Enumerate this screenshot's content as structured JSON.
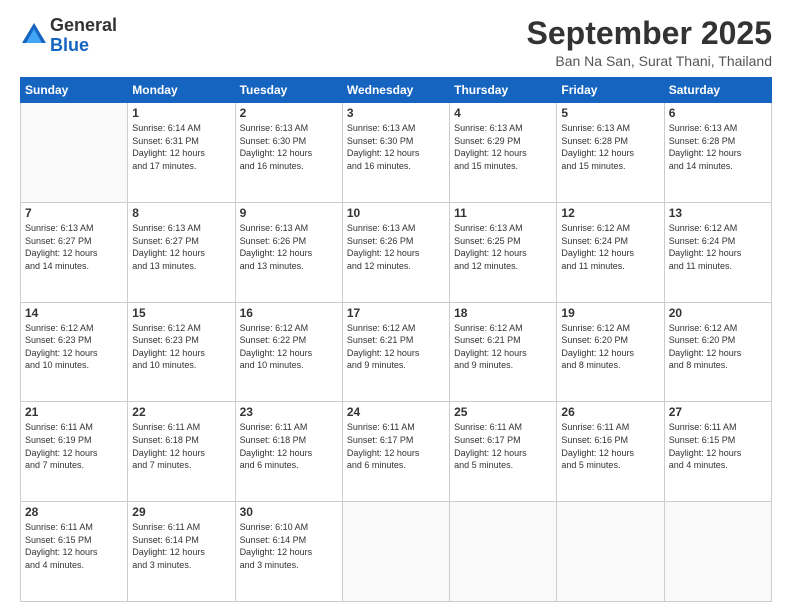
{
  "header": {
    "logo_general": "General",
    "logo_blue": "Blue",
    "title": "September 2025",
    "subtitle": "Ban Na San, Surat Thani, Thailand"
  },
  "days_of_week": [
    "Sunday",
    "Monday",
    "Tuesday",
    "Wednesday",
    "Thursday",
    "Friday",
    "Saturday"
  ],
  "weeks": [
    [
      {
        "day": "",
        "info": ""
      },
      {
        "day": "1",
        "info": "Sunrise: 6:14 AM\nSunset: 6:31 PM\nDaylight: 12 hours\nand 17 minutes."
      },
      {
        "day": "2",
        "info": "Sunrise: 6:13 AM\nSunset: 6:30 PM\nDaylight: 12 hours\nand 16 minutes."
      },
      {
        "day": "3",
        "info": "Sunrise: 6:13 AM\nSunset: 6:30 PM\nDaylight: 12 hours\nand 16 minutes."
      },
      {
        "day": "4",
        "info": "Sunrise: 6:13 AM\nSunset: 6:29 PM\nDaylight: 12 hours\nand 15 minutes."
      },
      {
        "day": "5",
        "info": "Sunrise: 6:13 AM\nSunset: 6:28 PM\nDaylight: 12 hours\nand 15 minutes."
      },
      {
        "day": "6",
        "info": "Sunrise: 6:13 AM\nSunset: 6:28 PM\nDaylight: 12 hours\nand 14 minutes."
      }
    ],
    [
      {
        "day": "7",
        "info": "Sunrise: 6:13 AM\nSunset: 6:27 PM\nDaylight: 12 hours\nand 14 minutes."
      },
      {
        "day": "8",
        "info": "Sunrise: 6:13 AM\nSunset: 6:27 PM\nDaylight: 12 hours\nand 13 minutes."
      },
      {
        "day": "9",
        "info": "Sunrise: 6:13 AM\nSunset: 6:26 PM\nDaylight: 12 hours\nand 13 minutes."
      },
      {
        "day": "10",
        "info": "Sunrise: 6:13 AM\nSunset: 6:26 PM\nDaylight: 12 hours\nand 12 minutes."
      },
      {
        "day": "11",
        "info": "Sunrise: 6:13 AM\nSunset: 6:25 PM\nDaylight: 12 hours\nand 12 minutes."
      },
      {
        "day": "12",
        "info": "Sunrise: 6:12 AM\nSunset: 6:24 PM\nDaylight: 12 hours\nand 11 minutes."
      },
      {
        "day": "13",
        "info": "Sunrise: 6:12 AM\nSunset: 6:24 PM\nDaylight: 12 hours\nand 11 minutes."
      }
    ],
    [
      {
        "day": "14",
        "info": "Sunrise: 6:12 AM\nSunset: 6:23 PM\nDaylight: 12 hours\nand 10 minutes."
      },
      {
        "day": "15",
        "info": "Sunrise: 6:12 AM\nSunset: 6:23 PM\nDaylight: 12 hours\nand 10 minutes."
      },
      {
        "day": "16",
        "info": "Sunrise: 6:12 AM\nSunset: 6:22 PM\nDaylight: 12 hours\nand 10 minutes."
      },
      {
        "day": "17",
        "info": "Sunrise: 6:12 AM\nSunset: 6:21 PM\nDaylight: 12 hours\nand 9 minutes."
      },
      {
        "day": "18",
        "info": "Sunrise: 6:12 AM\nSunset: 6:21 PM\nDaylight: 12 hours\nand 9 minutes."
      },
      {
        "day": "19",
        "info": "Sunrise: 6:12 AM\nSunset: 6:20 PM\nDaylight: 12 hours\nand 8 minutes."
      },
      {
        "day": "20",
        "info": "Sunrise: 6:12 AM\nSunset: 6:20 PM\nDaylight: 12 hours\nand 8 minutes."
      }
    ],
    [
      {
        "day": "21",
        "info": "Sunrise: 6:11 AM\nSunset: 6:19 PM\nDaylight: 12 hours\nand 7 minutes."
      },
      {
        "day": "22",
        "info": "Sunrise: 6:11 AM\nSunset: 6:18 PM\nDaylight: 12 hours\nand 7 minutes."
      },
      {
        "day": "23",
        "info": "Sunrise: 6:11 AM\nSunset: 6:18 PM\nDaylight: 12 hours\nand 6 minutes."
      },
      {
        "day": "24",
        "info": "Sunrise: 6:11 AM\nSunset: 6:17 PM\nDaylight: 12 hours\nand 6 minutes."
      },
      {
        "day": "25",
        "info": "Sunrise: 6:11 AM\nSunset: 6:17 PM\nDaylight: 12 hours\nand 5 minutes."
      },
      {
        "day": "26",
        "info": "Sunrise: 6:11 AM\nSunset: 6:16 PM\nDaylight: 12 hours\nand 5 minutes."
      },
      {
        "day": "27",
        "info": "Sunrise: 6:11 AM\nSunset: 6:15 PM\nDaylight: 12 hours\nand 4 minutes."
      }
    ],
    [
      {
        "day": "28",
        "info": "Sunrise: 6:11 AM\nSunset: 6:15 PM\nDaylight: 12 hours\nand 4 minutes."
      },
      {
        "day": "29",
        "info": "Sunrise: 6:11 AM\nSunset: 6:14 PM\nDaylight: 12 hours\nand 3 minutes."
      },
      {
        "day": "30",
        "info": "Sunrise: 6:10 AM\nSunset: 6:14 PM\nDaylight: 12 hours\nand 3 minutes."
      },
      {
        "day": "",
        "info": ""
      },
      {
        "day": "",
        "info": ""
      },
      {
        "day": "",
        "info": ""
      },
      {
        "day": "",
        "info": ""
      }
    ]
  ]
}
